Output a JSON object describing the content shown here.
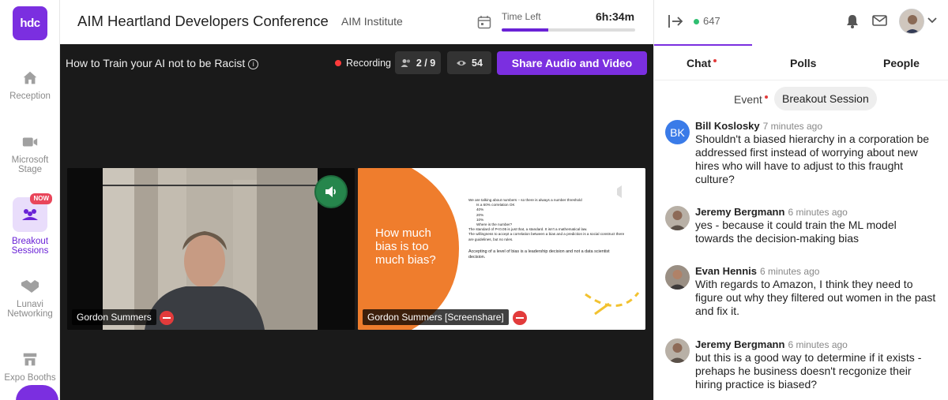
{
  "app": {
    "logo_text": "hdc",
    "event_title": "AIM Heartland Developers Conference",
    "org_name": "AIM Institute",
    "time_left_label": "Time Left",
    "time_left_value": "6h:34m",
    "time_elapsed_fraction": 0.35,
    "online_count": "647",
    "accent_color": "#7b2fe0"
  },
  "rail": {
    "items": [
      {
        "label": "Reception",
        "icon": "home-icon"
      },
      {
        "label": "Microsoft Stage",
        "icon": "video-camera-icon"
      },
      {
        "label": "Breakout Sessions",
        "icon": "group-icon",
        "badge": "NOW"
      },
      {
        "label": "Lunavi Networking",
        "icon": "handshake-icon"
      },
      {
        "label": "Expo Booths",
        "icon": "store-icon"
      }
    ]
  },
  "stage": {
    "session_title": "How to Train your AI not to be Racist",
    "recording_label": "Recording",
    "participants": "2 / 9",
    "viewers": "54",
    "share_button": "Share Audio and Video",
    "tiles": [
      {
        "name": "Gordon Summers"
      },
      {
        "name": "Gordon Summers [Screenshare]"
      }
    ],
    "slide": {
      "heading": "How much bias is too much bias?",
      "bullets": [
        "We are talking about numbers – so there is always a number threshold",
        "Is a 60% correlation OK",
        "40%",
        "20%",
        "10%",
        "Where is the number?",
        "The standard of P<0.05 is just that, a standard. It isn't a mathematical law.",
        "The willingness to accept a correlation between a bias and a prediction is a social construct there are guidelines, but no rules.",
        "Accepting of a level of bias is a leadership decision and not a data scientist decision."
      ]
    }
  },
  "panel": {
    "tabs": [
      "Chat",
      "Polls",
      "People"
    ],
    "subtabs": [
      "Event",
      "Breakout Session"
    ],
    "messages": [
      {
        "initials": "BK",
        "name": "Bill Koslosky",
        "time": "7 minutes ago",
        "text": "Shouldn't a biased hierarchy in a corporation be addressed first instead of worrying about new hires who will have to adjust to this fraught culture?"
      },
      {
        "name": "Jeremy Bergmann",
        "time": "6 minutes ago",
        "text": "yes - because it could train the ML model towards the decision-making bias"
      },
      {
        "name": "Evan Hennis",
        "time": "6 minutes ago",
        "text": "With regards to Amazon, I think they need to figure out why they filtered out women in the past and fix it."
      },
      {
        "name": "Jeremy Bergmann",
        "time": "6 minutes ago",
        "text": "but this is a good way to determine if it exists - prehaps he business doesn't recgonize their hiring practice is biased?"
      }
    ]
  }
}
